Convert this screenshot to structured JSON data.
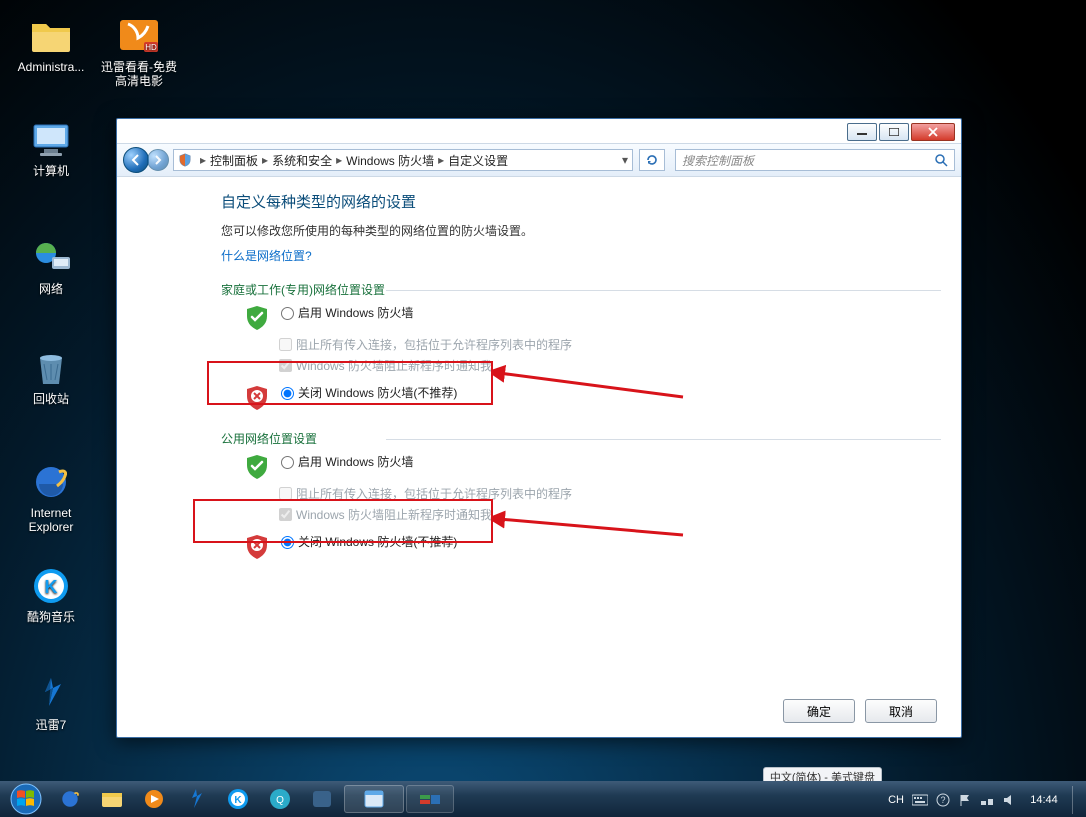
{
  "desktop_icons": {
    "administrator": "Administra...",
    "xunlei_kankan": "迅雷看看-免费高清电影",
    "computer": "计算机",
    "network": "网络",
    "recycle": "回收站",
    "ie_line1": "Internet",
    "ie_line2": "Explorer",
    "kugou": "酷狗音乐",
    "xunlei7": "迅雷7"
  },
  "breadcrumb": {
    "a": "控制面板",
    "b": "系统和安全",
    "c": "Windows 防火墙",
    "d": "自定义设置"
  },
  "search": {
    "placeholder": "搜索控制面板"
  },
  "page": {
    "title": "自定义每种类型的网络的设置",
    "desc": "您可以修改您所使用的每种类型的网络位置的防火墙设置。",
    "whatlink": "什么是网络位置?",
    "home_section": "家庭或工作(专用)网络位置设置",
    "public_section": "公用网络位置设置",
    "enable_label": "启用 Windows 防火墙",
    "block_label": "阻止所有传入连接，包括位于允许程序列表中的程序",
    "notify_label": "Windows 防火墙阻止新程序时通知我",
    "disable_label": "关闭 Windows 防火墙(不推荐)"
  },
  "buttons": {
    "ok": "确定",
    "cancel": "取消"
  },
  "taskbar": {
    "lang_pill": "中文(简体) - 美式键盘",
    "lang_short": "CH",
    "clock": "14:44"
  }
}
